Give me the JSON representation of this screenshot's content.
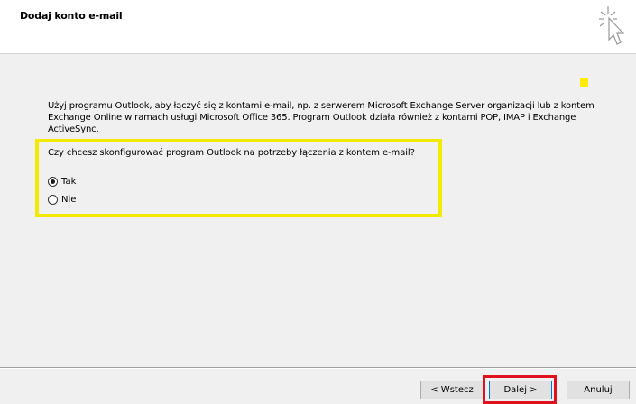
{
  "dialog": {
    "title": "Dodaj konto e-mail",
    "header_icon": "wizard-cursor-sparkle-icon"
  },
  "content": {
    "intro_text": "Użyj programu Outlook, aby łączyć się z kontami e-mail, np. z serwerem Microsoft Exchange Server organizacji lub z kontem Exchange Online w ramach usługi Microsoft Office 365. Program Outlook działa również z kontami POP, IMAP i Exchange ActiveSync.",
    "question": "Czy chcesz skonfigurować program Outlook na potrzeby łączenia z kontem e-mail?",
    "options": [
      {
        "label": "Tak",
        "selected": true
      },
      {
        "label": "Nie",
        "selected": false
      }
    ]
  },
  "buttons": {
    "back": "< Wstecz",
    "next": "Dalej >",
    "cancel": "Anuluj"
  },
  "colors": {
    "highlight": "#f2ea00",
    "next_frame": "#e0101c"
  }
}
